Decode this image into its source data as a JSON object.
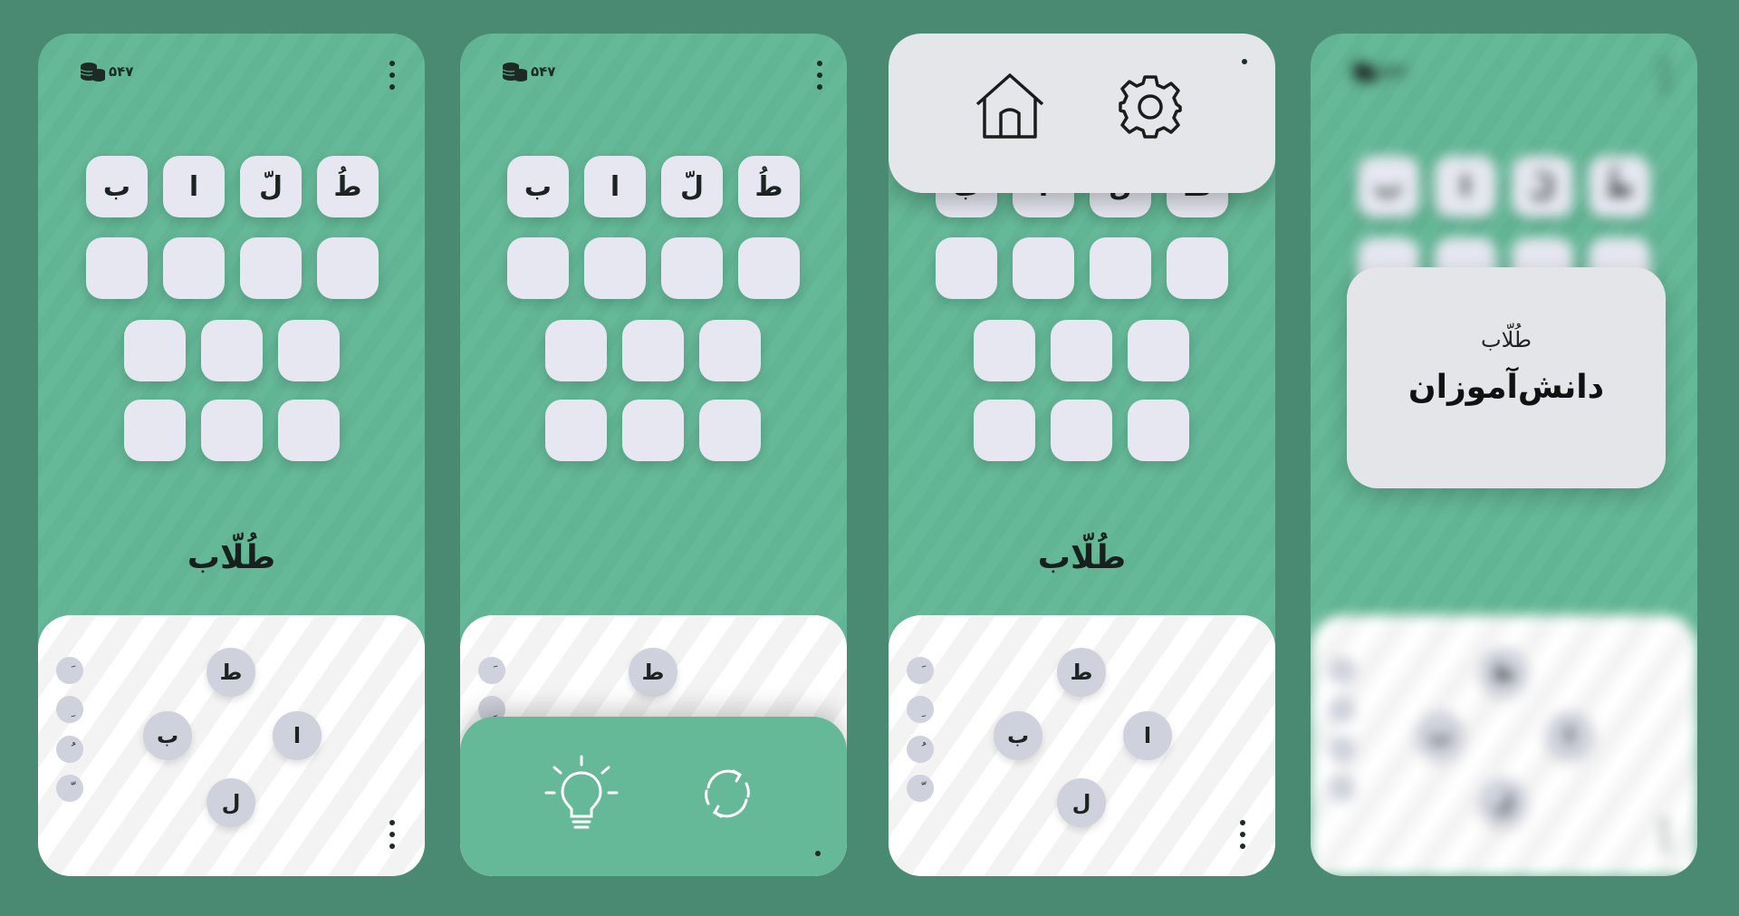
{
  "coins": "۵۴۷",
  "grid_letters": [
    "ب",
    "ا",
    "لّ",
    "طُ"
  ],
  "word": "طُلّاب",
  "diacritics": [
    "َ",
    "ِ",
    "ُ",
    "ّ"
  ],
  "wheel_letters": {
    "top": "ط",
    "left": "ب",
    "right": "ا",
    "bottom": "ل"
  },
  "card": {
    "sub": "طُلّاب",
    "main": "دانش‌آموزان"
  },
  "icons": {
    "coins": "coins-icon",
    "menu": "kebab-menu-icon",
    "home": "home-icon",
    "settings": "gear-icon",
    "hint": "lightbulb-icon",
    "shuffle": "refresh-icon"
  },
  "colors": {
    "background": "#4a8a72",
    "screen": "#65b898",
    "tile": "#e6e7f0",
    "panel": "#e4e6e9"
  }
}
